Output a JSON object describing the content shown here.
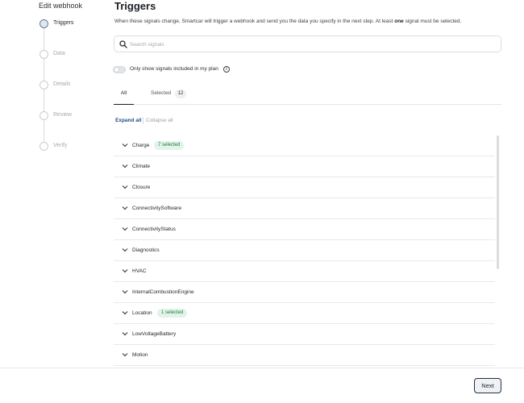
{
  "sidebar": {
    "title": "Edit webhook",
    "steps": [
      {
        "label": "Triggers"
      },
      {
        "label": "Data"
      },
      {
        "label": "Details"
      },
      {
        "label": "Review"
      },
      {
        "label": "Verify"
      }
    ]
  },
  "header": {
    "title": "Triggers",
    "subtitle_before": "When these signals change, Smartcar will trigger a webhook and send you the data you specify in the next step. At least ",
    "subtitle_bold": "one",
    "subtitle_after": " signal must be selected."
  },
  "search": {
    "placeholder": "Search signals",
    "value": ""
  },
  "toggle": {
    "label": "Only show signals included in my plan",
    "on": false
  },
  "tabs": {
    "all_label": "All",
    "selected_label": "Selected",
    "selected_count": "12"
  },
  "controls": {
    "expand_all": "Expand all",
    "collapse_all": "Collapse all"
  },
  "signals": [
    {
      "label": "Charge",
      "badge": "7 selected"
    },
    {
      "label": "Climate",
      "badge": ""
    },
    {
      "label": "Closure",
      "badge": ""
    },
    {
      "label": "ConnectivitySoftware",
      "badge": ""
    },
    {
      "label": "ConnectivityStatus",
      "badge": ""
    },
    {
      "label": "Diagnostics",
      "badge": ""
    },
    {
      "label": "HVAC",
      "badge": ""
    },
    {
      "label": "InternalCombustionEngine",
      "badge": ""
    },
    {
      "label": "Location",
      "badge": "1 selected"
    },
    {
      "label": "LowVoltageBattery",
      "badge": ""
    },
    {
      "label": "Motion",
      "badge": ""
    }
  ],
  "footer": {
    "next_label": "Next"
  },
  "colors": {
    "badge_bg": "#e2f4e8",
    "badge_text": "#1e7a45",
    "link": "#1e4f86"
  }
}
